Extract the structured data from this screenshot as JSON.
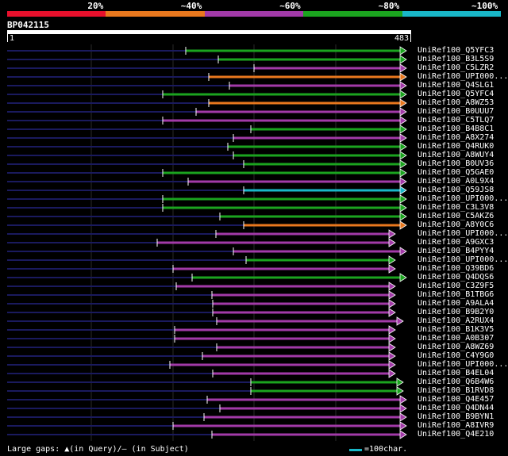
{
  "legend": {
    "colors": [
      "#e8102c",
      "#e9781e",
      "#a23aa8",
      "#1ba41f",
      "#19b7c8"
    ],
    "labels": [
      "20%",
      "~40%",
      "~60%",
      "~80%",
      "~100%"
    ]
  },
  "query": {
    "id": "BP042115",
    "start": "1",
    "end": "483"
  },
  "hits": [
    {
      "label": "UniRef100_Q5YFC3",
      "color": "green"
    },
    {
      "label": "UniRef100_B3L5S9",
      "color": "green"
    },
    {
      "label": "UniRef100_C5LZR2",
      "color": "purple"
    },
    {
      "label": "UniRef100_UPI000...",
      "color": "orange"
    },
    {
      "label": "UniRef100_Q4SLG1",
      "color": "purple"
    },
    {
      "label": "UniRef100_Q5YFC4",
      "color": "green"
    },
    {
      "label": "UniRef100_A8WZ53",
      "color": "orange"
    },
    {
      "label": "UniRef100_B0UUU7",
      "color": "purple"
    },
    {
      "label": "UniRef100_C5TLQ7",
      "color": "purple"
    },
    {
      "label": "UniRef100_B4B8C1",
      "color": "green"
    },
    {
      "label": "UniRef100_A8X274",
      "color": "purple"
    },
    {
      "label": "UniRef100_Q4RUK0",
      "color": "green"
    },
    {
      "label": "UniRef100_A8WUY4",
      "color": "green"
    },
    {
      "label": "UniRef100_B0UV36",
      "color": "green"
    },
    {
      "label": "UniRef100_Q5GAE0",
      "color": "green"
    },
    {
      "label": "UniRef100_A0L9X4",
      "color": "purple"
    },
    {
      "label": "UniRef100_Q59JS8",
      "color": "cyan"
    },
    {
      "label": "UniRef100_UPI000...",
      "color": "green"
    },
    {
      "label": "UniRef100_C3L3V8",
      "color": "green"
    },
    {
      "label": "UniRef100_C5AKZ6",
      "color": "green"
    },
    {
      "label": "UniRef100_A8Y0C6",
      "color": "orange"
    },
    {
      "label": "UniRef100_UPI000...",
      "color": "purple"
    },
    {
      "label": "UniRef100_A9GXC3",
      "color": "purple"
    },
    {
      "label": "UniRef100_B4PYY4",
      "color": "purple"
    },
    {
      "label": "UniRef100_UPI000...",
      "color": "green"
    },
    {
      "label": "UniRef100_Q39BD6",
      "color": "purple"
    },
    {
      "label": "UniRef100_Q4DQS6",
      "color": "green"
    },
    {
      "label": "UniRef100_C3Z9F5",
      "color": "purple"
    },
    {
      "label": "UniRef100_B1TBG6",
      "color": "purple"
    },
    {
      "label": "UniRef100_A9ALA4",
      "color": "purple"
    },
    {
      "label": "UniRef100_B9B2Y0",
      "color": "purple"
    },
    {
      "label": "UniRef100_A2RUX4",
      "color": "purple"
    },
    {
      "label": "UniRef100_B1K3V5",
      "color": "purple"
    },
    {
      "label": "UniRef100_A0B307",
      "color": "purple"
    },
    {
      "label": "UniRef100_A8WZ69",
      "color": "purple"
    },
    {
      "label": "UniRef100_C4Y9G0",
      "color": "purple"
    },
    {
      "label": "UniRef100_UPI000...",
      "color": "purple"
    },
    {
      "label": "UniRef100_B4EL04",
      "color": "purple"
    },
    {
      "label": "UniRef100_Q6B4W6",
      "color": "green"
    },
    {
      "label": "UniRef100_B1RVD8",
      "color": "green"
    },
    {
      "label": "UniRef100_Q4E457",
      "color": "purple"
    },
    {
      "label": "UniRef100_Q4DN44",
      "color": "purple"
    },
    {
      "label": "UniRef100_B9BYN1",
      "color": "purple"
    },
    {
      "label": "UniRef100_A8IVR9",
      "color": "purple"
    },
    {
      "label": "UniRef100_Q4E210",
      "color": "purple"
    }
  ],
  "footer": {
    "gaps_text": "Large gaps: ▲(in Query)/— (in Subject)",
    "scale_text": "=100char."
  }
}
